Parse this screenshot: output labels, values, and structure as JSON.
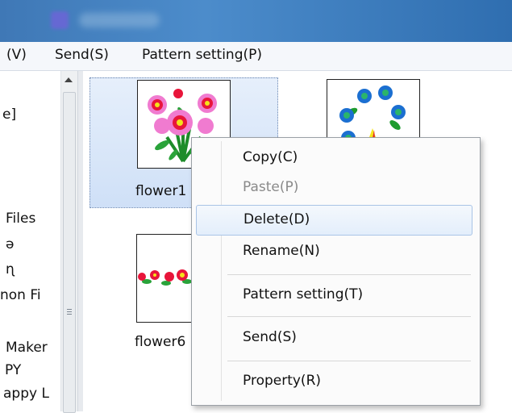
{
  "menubar": {
    "items": [
      "(V)",
      "Send(S)",
      "Pattern setting(P)"
    ]
  },
  "tree": {
    "items": [
      "e]",
      "Files",
      "ə",
      "ɳ",
      "non Fi",
      "Maker",
      "PY",
      "appy L"
    ]
  },
  "tiles": [
    {
      "label": "flower1"
    },
    {
      "label": "flower6"
    }
  ],
  "context_menu": {
    "items": [
      {
        "label": "Copy(C)",
        "enabled": true
      },
      {
        "label": "Paste(P)",
        "enabled": false
      },
      {
        "label": "Delete(D)",
        "enabled": true,
        "highlighted": true
      },
      {
        "label": "Rename(N)",
        "enabled": true
      },
      {
        "label": "Pattern setting(T)",
        "enabled": true
      },
      {
        "label": "Send(S)",
        "enabled": true
      },
      {
        "label": "Property(R)",
        "enabled": true
      }
    ]
  },
  "icons": {
    "scroll_up": "chevron-up-icon",
    "scroll_grip": "grip-icon"
  }
}
